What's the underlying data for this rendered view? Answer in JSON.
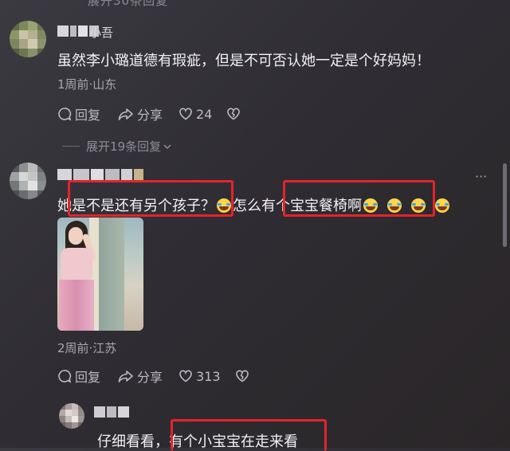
{
  "top_fade_text": "展开30条回复",
  "comment1": {
    "username": "小吾",
    "text": "虽然李小璐道德有瑕疵，但是不可否认她一定是个好妈妈！",
    "meta": "1周前·山东",
    "reply_label": "回复",
    "share_label": "分享",
    "like_count": "24"
  },
  "expand_replies": "展开19条回复",
  "comment2": {
    "text_part1": "她",
    "text_part2": "是不是还有另个孩子？",
    "text_part3": "怎么",
    "text_part4": "有个宝宝餐椅啊",
    "meta": "2周前·江苏",
    "reply_label": "回复",
    "share_label": "分享",
    "like_count": "313",
    "more_label": "···"
  },
  "comment3": {
    "text_part1": "仔细看看，",
    "text_part2": "有个小宝宝在走来看"
  },
  "colors": {
    "highlight_box": "#e5232a",
    "background": "#2f2d33"
  },
  "icons": [
    "chat-bubble-icon",
    "share-arrow-icon",
    "heart-icon",
    "broken-heart-icon",
    "laughing-emoji-icon",
    "chevron-down-icon"
  ]
}
